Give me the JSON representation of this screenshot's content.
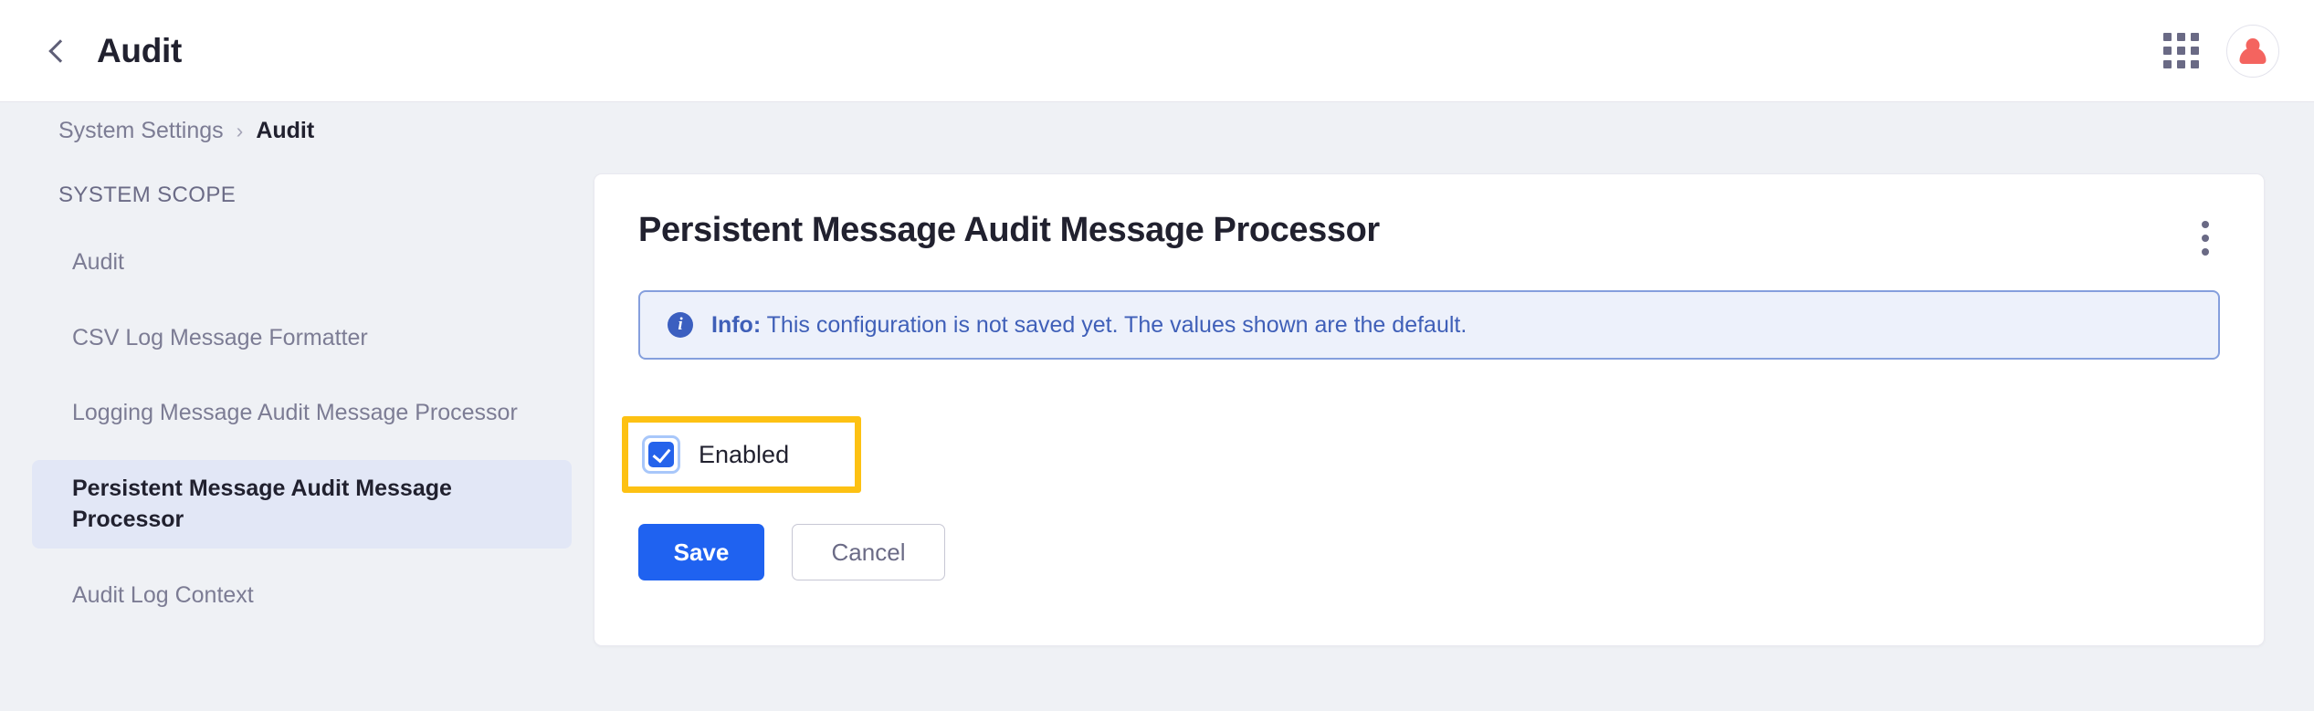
{
  "header": {
    "back_icon": "chevron-left-icon",
    "title": "Audit",
    "apps_icon": "grid-apps-icon",
    "avatar_icon": "user-avatar-icon",
    "avatar_color": "#f4645f"
  },
  "breadcrumb": {
    "parent": "System Settings",
    "separator": "›",
    "current": "Audit"
  },
  "sidebar": {
    "scope_label": "SYSTEM SCOPE",
    "selected_index": 3,
    "items": [
      {
        "label": "Audit",
        "selected": false
      },
      {
        "label": "CSV Log Message Formatter",
        "selected": false
      },
      {
        "label": "Logging Message Audit Message Processor",
        "selected": false
      },
      {
        "label": "Persistent Message Audit Message Processor",
        "selected": true
      },
      {
        "label": "Audit Log Context",
        "selected": false
      }
    ]
  },
  "card": {
    "title": "Persistent Message Audit Message Processor",
    "menu_icon": "kebab-menu-icon",
    "info": {
      "icon": "info-circle-icon",
      "icon_glyph": "i",
      "label": "Info:",
      "message": "This configuration is not saved yet. The values shown are the default.",
      "accent_color": "#3b5fc0",
      "background": "#edf1fb",
      "border_color": "#859fdd"
    },
    "checkbox": {
      "label": "Enabled",
      "checked": true,
      "focused": true,
      "accent_color": "#2563eb",
      "focus_ring_color": "#a8c7fa"
    },
    "highlight": {
      "name": "annotation-highlight",
      "color": "#fdc113"
    },
    "buttons": {
      "save": "Save",
      "cancel": "Cancel",
      "save_color": "#1f62f0"
    }
  }
}
